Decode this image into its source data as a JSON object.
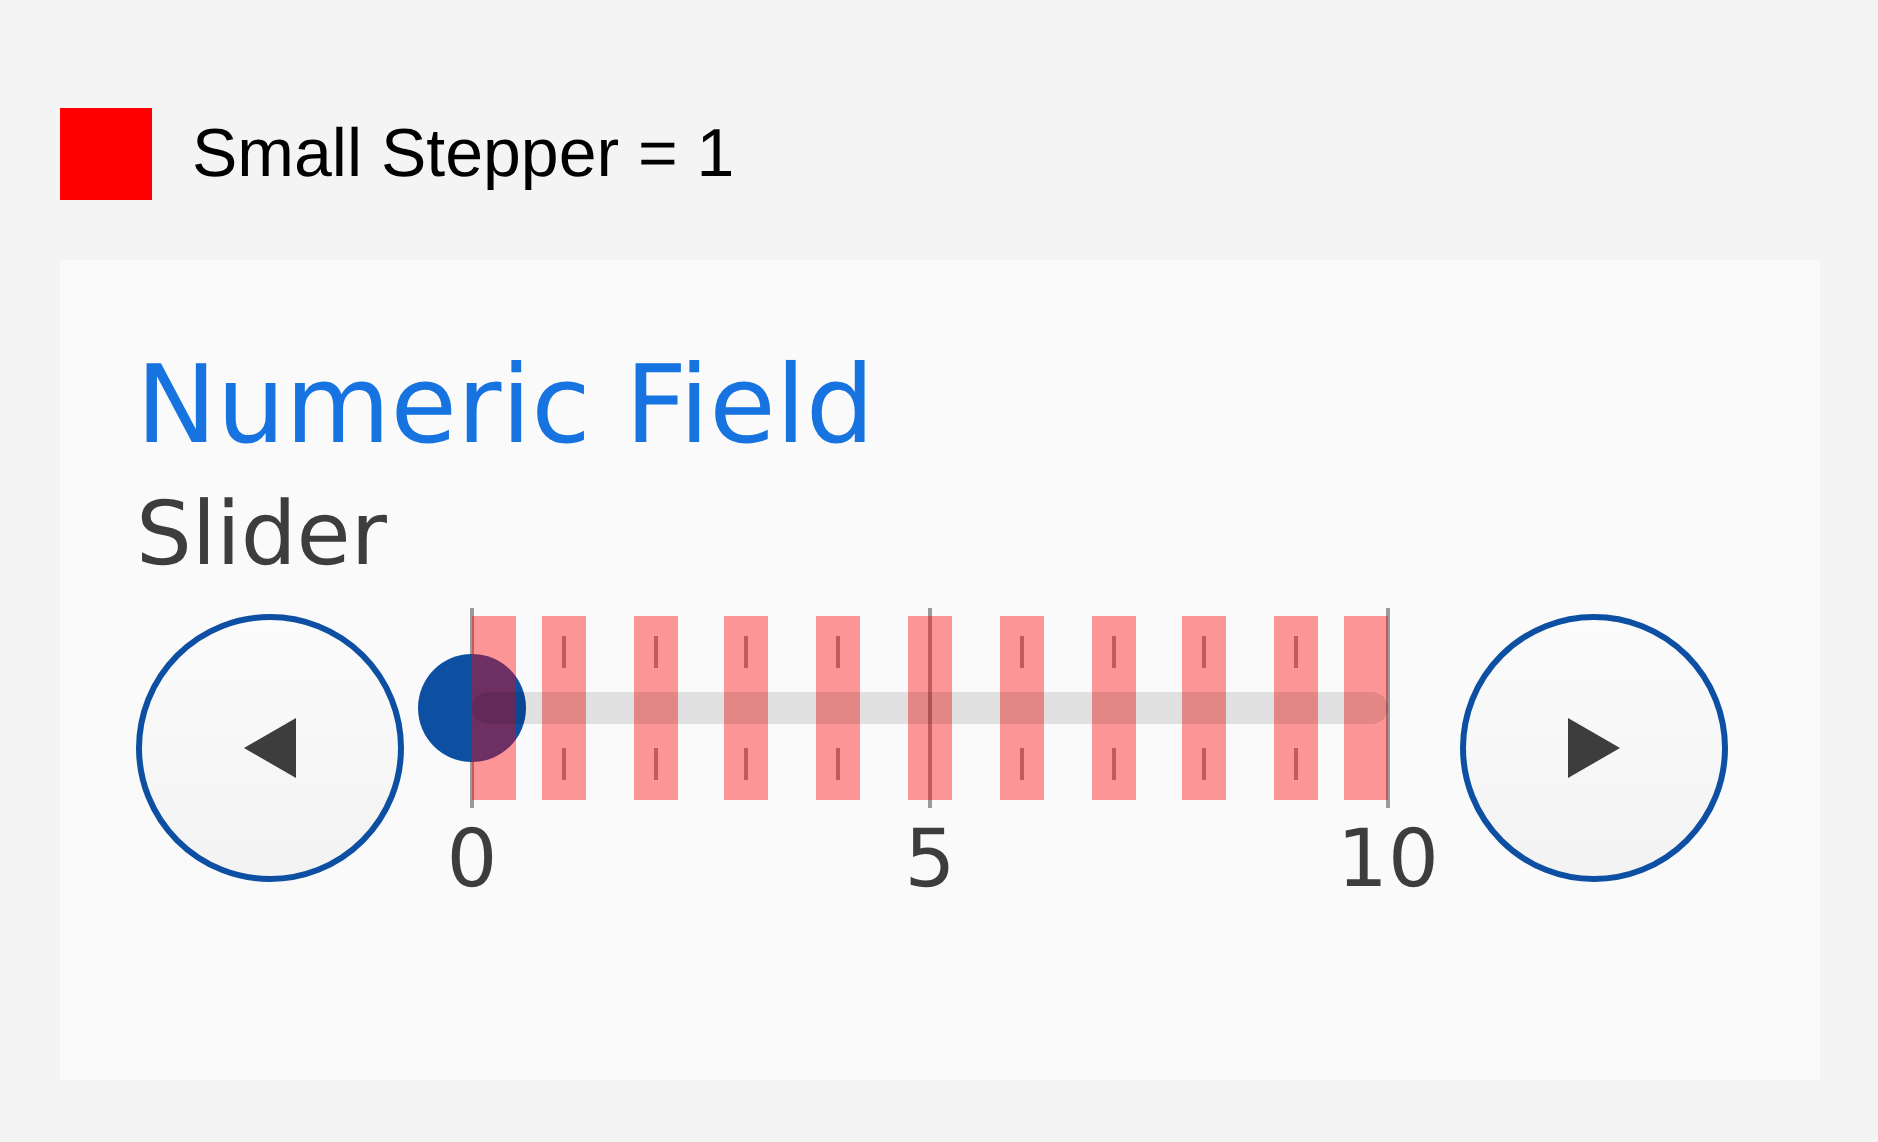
{
  "legend": {
    "label": "Small Stepper = 1",
    "color": "#ff0000"
  },
  "card": {
    "title": "Numeric Field",
    "subtitle": "Slider"
  },
  "slider": {
    "level": 0,
    "ticks": [
      {
        "major": true,
        "highlighted": true,
        "label": "0"
      },
      {
        "major": false,
        "highlighted": true
      },
      {
        "major": false,
        "highlighted": true
      },
      {
        "major": false,
        "highlighted": true
      },
      {
        "major": false,
        "highlighted": true
      },
      {
        "major": true,
        "highlighted": true,
        "label": "5"
      },
      {
        "major": false,
        "highlighted": true
      },
      {
        "major": false,
        "highlighted": true
      },
      {
        "major": false,
        "highlighted": true
      },
      {
        "major": false,
        "highlighted": true
      },
      {
        "major": true,
        "highlighted": true,
        "label": "10"
      }
    ]
  }
}
